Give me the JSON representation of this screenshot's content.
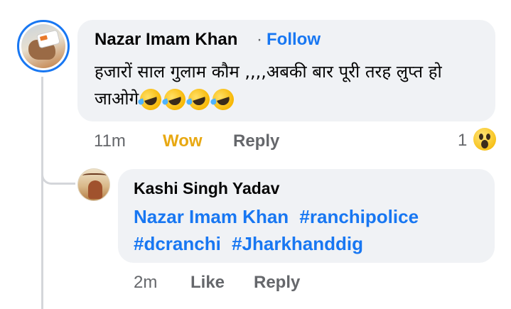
{
  "comment": {
    "author": "Nazar Imam Khan",
    "separator": "·",
    "follow_label": "Follow",
    "text": "हजारों साल गुलाम कौम ,,,,अबकी बार पूरी तरह लुप्त हो जाओगे",
    "emojis": [
      "rolling-on-floor-laughing-emoji",
      "rolling-on-floor-laughing-emoji",
      "rolling-on-floor-laughing-emoji",
      "rolling-on-floor-laughing-emoji"
    ],
    "time": "11m",
    "reaction_label": "Wow",
    "reply_label": "Reply",
    "reaction_count": "1",
    "reaction_icon": "wow-emoji-icon"
  },
  "reply": {
    "author": "Kashi Singh Yadav",
    "mention": "Nazar Imam Khan",
    "hashtags": [
      "#ranchipolice",
      "#dcranchi",
      "#Jharkhanddig"
    ],
    "time": "2m",
    "like_label": "Like",
    "reply_label": "Reply"
  },
  "colors": {
    "link_blue": "#1877f2",
    "wow_yellow": "#e8a812",
    "bubble_bg": "#f0f2f5",
    "meta_gray": "#65676b"
  }
}
